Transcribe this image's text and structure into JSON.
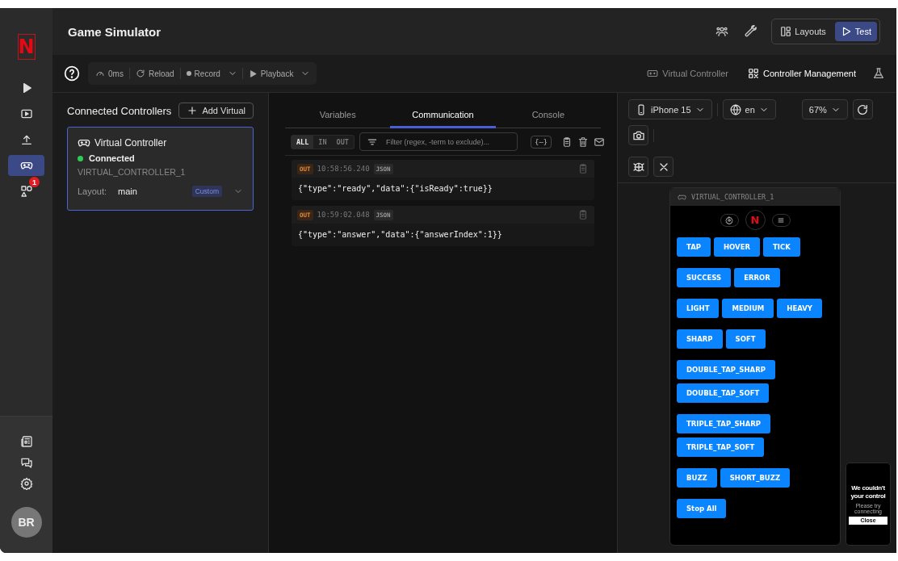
{
  "rail": {
    "logo": "N",
    "items": [
      {
        "selected": false
      },
      {
        "selected": false
      },
      {
        "selected": false
      },
      {
        "selected": true
      },
      {
        "selected": false,
        "badge": "1"
      }
    ],
    "avatar": "BR"
  },
  "window": {
    "title": "Game Simulator"
  },
  "header": {
    "modes": [
      {
        "label": "Layouts",
        "selected": false
      },
      {
        "label": "Test",
        "selected": true
      }
    ]
  },
  "toolbar": {
    "latency": "0ms",
    "reload": "Reload",
    "record": "Record",
    "playback": "Playback",
    "views": [
      {
        "label": "Virtual Controller",
        "selected": false
      },
      {
        "label": "Controller Management",
        "selected": true
      }
    ]
  },
  "controllers": {
    "title": "Connected Controllers",
    "add_button": "Add Virtual",
    "cards": [
      {
        "name": "Virtual Controller",
        "status": "Connected",
        "connected": true,
        "id": "VIRTUAL_CONTROLLER_1",
        "layout_label": "Layout:",
        "layout": "main",
        "tag": "Custom",
        "selected": true
      }
    ]
  },
  "communication": {
    "tabs": [
      {
        "label": "Variables",
        "selected": false
      },
      {
        "label": "Communication",
        "selected": true
      },
      {
        "label": "Console",
        "selected": false
      }
    ],
    "directions": [
      {
        "label": "ALL",
        "selected": true
      },
      {
        "label": "IN",
        "selected": false
      },
      {
        "label": "OUT",
        "selected": false
      }
    ],
    "filter": {
      "placeholder": "Filter (regex, -term to exclude)..."
    },
    "format_button": "{–}",
    "messages": [
      {
        "kind": "out",
        "direction": "OUT",
        "time": "10:58:56.240",
        "format": "JSON",
        "body": "{\"type\":\"ready\",\"data\":{\"isReady\":true}}"
      },
      {
        "kind": "out",
        "direction": "OUT",
        "time": "10:59:02.048",
        "format": "JSON",
        "body": "{\"type\":\"answer\",\"data\":{\"answerIndex\":1}}"
      }
    ]
  },
  "preview": {
    "device": "iPhone 15",
    "language": "en",
    "zoom": "67%",
    "controller": {
      "title": "VIRTUAL_CONTROLLER_1",
      "logo": "N",
      "groups": [
        [
          "TAP",
          "HOVER",
          "TICK"
        ],
        [
          "SUCCESS",
          "ERROR"
        ],
        [
          "LIGHT",
          "MEDIUM",
          "HEAVY"
        ],
        [
          "SHARP",
          "SOFT"
        ],
        [
          "DOUBLE_TAP_SHARP",
          "DOUBLE_TAP_SOFT"
        ],
        [
          "TRIPLE_TAP_SHARP",
          "TRIPLE_TAP_SOFT"
        ],
        [
          "BUZZ",
          "SHORT_BUZZ"
        ],
        [
          "Stop All"
        ]
      ]
    },
    "mini_screen": {
      "lines": [
        "We couldn't",
        "your control"
      ],
      "note": "Please try connecting",
      "button": "Close"
    }
  }
}
